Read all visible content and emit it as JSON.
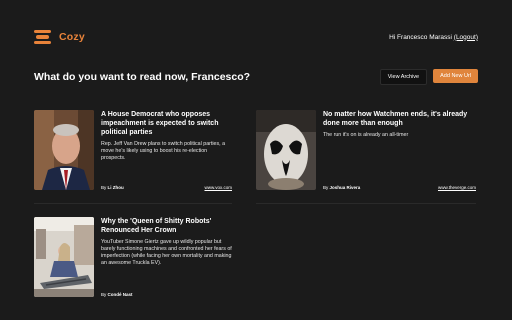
{
  "header": {
    "brand": "Cozy",
    "greeting": "Hi Francesco Marassi",
    "logout_label": "(Logout)"
  },
  "main": {
    "question": "What do you want to read now, Francesco?",
    "view_archive_label": "View Archive",
    "add_url_label": "Add New Url"
  },
  "articles": [
    {
      "title": "A House Democrat who opposes impeachment is expected to switch political parties",
      "description": "Rep. Jeff Van Drew plans to switch political parties, a move he's likely using to boost his re-election prospects.",
      "by_prefix": "By",
      "author": "Li Zhou",
      "source": "www.vox.com"
    },
    {
      "title": "No matter how Watchmen ends, it's already done more than enough",
      "description": "The run it's on is already an all-timer",
      "by_prefix": "By",
      "author": "Joshua Rivera",
      "source": "www.theverge.com"
    },
    {
      "title": "Why the 'Queen of Shitty Robots' Renounced Her Crown",
      "description": "YouTuber Simone Giertz gave up wildly popular but barely functioning machines and confronted her fears of imperfection (while facing her own mortality and making an awesome Truckla EV).",
      "by_prefix": "By",
      "author": "Condé Nast",
      "source": ""
    }
  ],
  "colors": {
    "accent": "#e8833a",
    "background": "#1b1b1b"
  }
}
